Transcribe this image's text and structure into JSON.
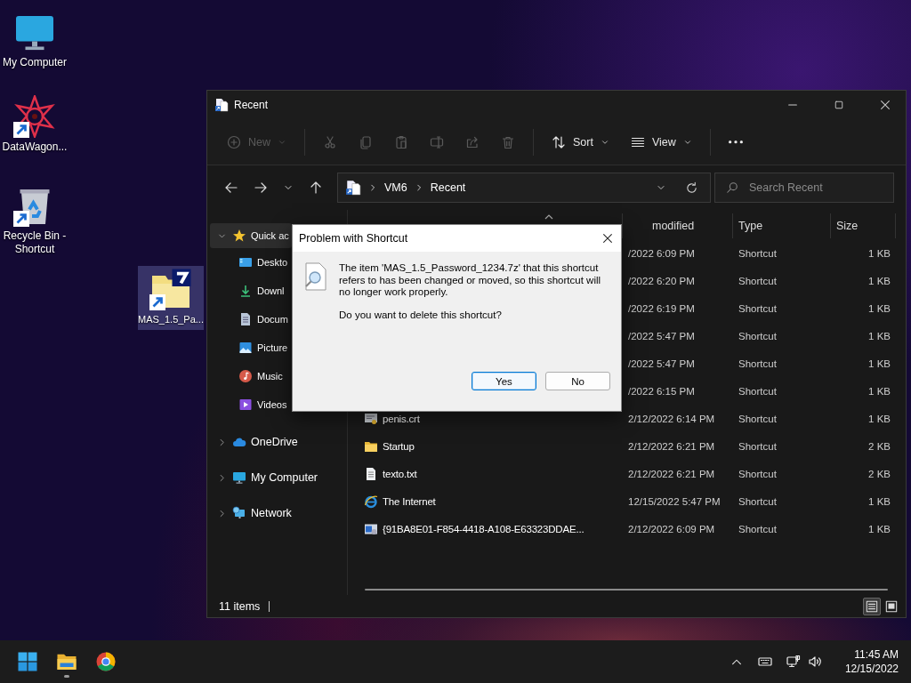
{
  "desktop_icons": [
    {
      "label": "My Computer",
      "kind": "monitor",
      "shortcut": false,
      "selected": false
    },
    {
      "label": "DataWagon...",
      "kind": "emblem",
      "shortcut": true,
      "selected": false
    },
    {
      "label": "Recycle Bin - Shortcut",
      "kind": "recycle",
      "shortcut": true,
      "selected": false
    },
    {
      "label": "MAS_1.5_Pa...",
      "kind": "archive",
      "shortcut": true,
      "selected": true
    }
  ],
  "explorer": {
    "title": "Recent",
    "toolbar": [
      {
        "kind": "new",
        "label": "New",
        "disabled": true
      },
      {
        "kind": "cut",
        "disabled": true
      },
      {
        "kind": "copy",
        "disabled": true
      },
      {
        "kind": "paste",
        "disabled": true
      },
      {
        "kind": "rename",
        "disabled": true
      },
      {
        "kind": "share",
        "disabled": true
      },
      {
        "kind": "delete",
        "disabled": true
      },
      {
        "kind": "sort",
        "label": "Sort",
        "disabled": false
      },
      {
        "kind": "view",
        "label": "View",
        "disabled": false
      },
      {
        "kind": "more",
        "disabled": false
      }
    ],
    "address": {
      "crumbs": [
        "VM6",
        "Recent"
      ]
    },
    "search": {
      "placeholder": "Search Recent"
    },
    "sidebar": [
      {
        "label": "Quick ac",
        "kind": "star",
        "expanded": true,
        "selected": true,
        "children": [
          {
            "label": "Deskto",
            "kind": "desktop",
            "selected": false
          },
          {
            "label": "Downl",
            "kind": "download",
            "selected": false
          },
          {
            "label": "Docum",
            "kind": "document",
            "selected": false
          },
          {
            "label": "Picture",
            "kind": "picture",
            "selected": false
          },
          {
            "label": "Music",
            "kind": "music",
            "selected": false
          },
          {
            "label": "Videos",
            "kind": "video",
            "selected": false
          }
        ]
      },
      {
        "label": "OneDrive",
        "kind": "cloud",
        "expanded": false,
        "selected": false
      },
      {
        "label": "My Computer",
        "kind": "monitor",
        "expanded": false,
        "selected": false
      },
      {
        "label": "Network",
        "kind": "network",
        "expanded": false,
        "selected": false
      }
    ],
    "columns": [
      "modified",
      "Type",
      "Size"
    ],
    "rows": [
      {
        "date": "/2022 6:09 PM",
        "type": "Shortcut",
        "size": "1 KB"
      },
      {
        "date": "/2022 6:20 PM",
        "type": "Shortcut",
        "size": "1 KB"
      },
      {
        "date": "/2022 6:19 PM",
        "type": "Shortcut",
        "size": "1 KB"
      },
      {
        "date": "/2022 5:47 PM",
        "type": "Shortcut",
        "size": "1 KB"
      },
      {
        "date": "/2022 5:47 PM",
        "type": "Shortcut",
        "size": "1 KB"
      },
      {
        "date": "/2022 6:15 PM",
        "type": "Shortcut",
        "size": "1 KB"
      },
      {
        "kind": "cert",
        "name": "penis.crt",
        "date": "2/12/2022 6:14 PM",
        "type": "Shortcut",
        "size": "1 KB"
      },
      {
        "kind": "folder",
        "name": "Startup",
        "date": "2/12/2022 6:21 PM",
        "type": "Shortcut",
        "size": "2 KB"
      },
      {
        "kind": "text",
        "name": "texto.txt",
        "date": "2/12/2022 6:21 PM",
        "type": "Shortcut",
        "size": "2 KB"
      },
      {
        "kind": "ie",
        "name": "The Internet",
        "date": "12/15/2022 5:47 PM",
        "type": "Shortcut",
        "size": "1 KB"
      },
      {
        "kind": "app",
        "name": "{91BA8E01-F854-4418-A108-E63323DDAE...",
        "date": "2/12/2022 6:09 PM",
        "type": "Shortcut",
        "size": "1 KB"
      }
    ],
    "status": "11 items",
    "view_buttons": [
      {
        "kind": "details",
        "selected": true
      },
      {
        "kind": "tiles",
        "selected": false
      }
    ]
  },
  "dialog": {
    "title": "Problem with Shortcut",
    "message": "The item 'MAS_1.5_Password_1234.7z' that this shortcut refers to has been changed or moved, so this shortcut will no longer work properly.",
    "question": "Do you want to delete this shortcut?",
    "buttons": [
      {
        "label": "Yes",
        "focused": true
      },
      {
        "label": "No",
        "focused": false
      }
    ]
  },
  "taskbar": {
    "apps": [
      {
        "kind": "start",
        "running": false
      },
      {
        "kind": "explorer",
        "running": true
      },
      {
        "kind": "chrome",
        "running": false
      }
    ],
    "time": "11:45 AM",
    "date": "12/15/2022"
  }
}
